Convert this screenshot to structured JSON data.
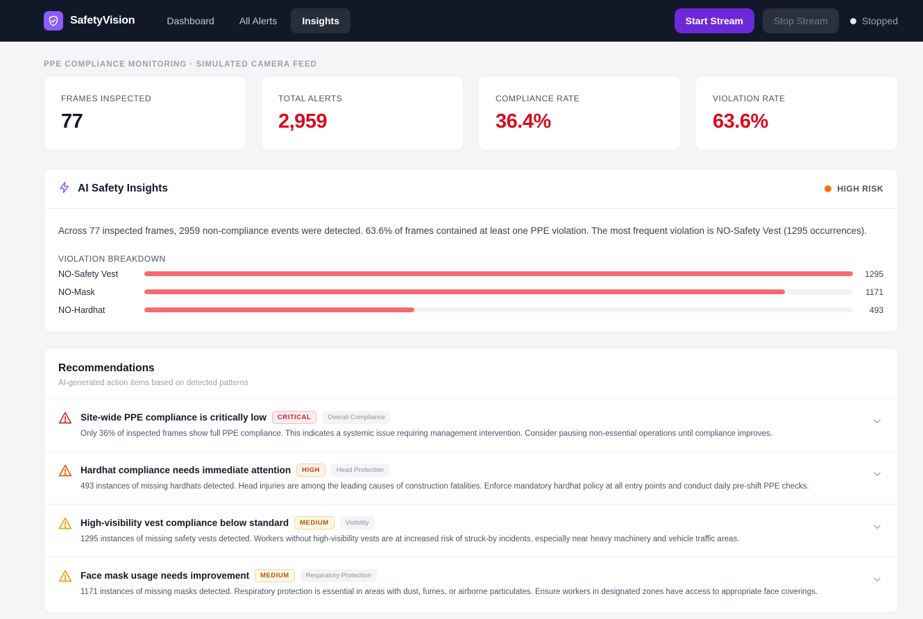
{
  "nav": {
    "brand": "SafetyVision",
    "links": [
      {
        "label": "Dashboard",
        "active": false
      },
      {
        "label": "All Alerts",
        "active": false
      },
      {
        "label": "Insights",
        "active": true
      }
    ],
    "start_label": "Start Stream",
    "stop_label": "Stop Stream",
    "status_label": "Stopped"
  },
  "eyebrow": "PPE COMPLIANCE MONITORING · SIMULATED CAMERA FEED",
  "stats": [
    {
      "label": "FRAMES INSPECTED",
      "value": "77"
    },
    {
      "label": "TOTAL ALERTS",
      "value": "2,959"
    },
    {
      "label": "COMPLIANCE RATE",
      "value": "36.4%"
    },
    {
      "label": "VIOLATION RATE",
      "value": "63.6%"
    }
  ],
  "insights": {
    "title": "AI Safety Insights",
    "risk_label": "HIGH RISK",
    "summary": "Across 77 inspected frames, 2959 non-compliance events were detected. 63.6% of frames contained at least one PPE violation. The most frequent violation is NO-Safety Vest (1295 occurrences).",
    "breakdown_label": "VIOLATION BREAKDOWN",
    "breakdown": [
      {
        "name": "NO-Safety Vest",
        "count": 1295,
        "count_label": "1295"
      },
      {
        "name": "NO-Mask",
        "count": 1171,
        "count_label": "1171"
      },
      {
        "name": "NO-Hardhat",
        "count": 493,
        "count_label": "493"
      }
    ]
  },
  "recommendations": {
    "title": "Recommendations",
    "subtitle": "AI-generated action items based on detected patterns",
    "items": [
      {
        "title": "Site-wide PPE compliance is critically low",
        "severity": "CRITICAL",
        "category": "Overall Compliance",
        "description": "Only 36% of inspected frames show full PPE compliance. This indicates a systemic issue requiring management intervention. Consider pausing non-essential operations until compliance improves."
      },
      {
        "title": "Hardhat compliance needs immediate attention",
        "severity": "HIGH",
        "category": "Head Protection",
        "description": "493 instances of missing hardhats detected. Head injuries are among the leading causes of construction fatalities. Enforce mandatory hardhat policy at all entry points and conduct daily pre-shift PPE checks."
      },
      {
        "title": "High-visibility vest compliance below standard",
        "severity": "MEDIUM",
        "category": "Visibility",
        "description": "1295 instances of missing safety vests detected. Workers without high-visibility vests are at increased risk of struck-by incidents, especially near heavy machinery and vehicle traffic areas."
      },
      {
        "title": "Face mask usage needs improvement",
        "severity": "MEDIUM",
        "category": "Respiratory Protection",
        "description": "1171 instances of missing masks detected. Respiratory protection is essential in areas with dust, fumes, or airborne particulates. Ensure workers in designated zones have access to appropriate face coverings."
      }
    ]
  },
  "colors": {
    "accent": "#6d28d9",
    "danger": "#d90b1e",
    "bar": "#f76b70",
    "risk": "#f97316",
    "critical_icon": "#dc2626",
    "high_icon": "#ea580c",
    "medium_icon": "#f59e0b"
  }
}
